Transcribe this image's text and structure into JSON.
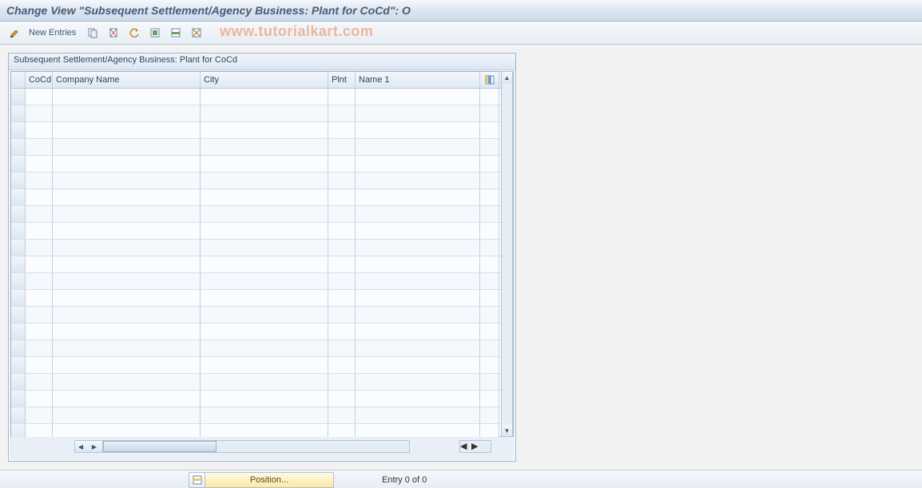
{
  "header": {
    "title": "Change View \"Subsequent Settlement/Agency Business: Plant for CoCd\": O"
  },
  "toolbar": {
    "new_entries_label": "New Entries"
  },
  "watermark": "www.tutorialkart.com",
  "panel": {
    "title": "Subsequent Settlement/Agency Business: Plant for CoCd",
    "columns": {
      "cocd": "CoCd",
      "company_name": "Company Name",
      "city": "City",
      "plnt": "Plnt",
      "name1": "Name 1"
    },
    "rows": [
      {
        "cocd": "",
        "company_name": "",
        "city": "",
        "plnt": "",
        "name1": ""
      },
      {
        "cocd": "",
        "company_name": "",
        "city": "",
        "plnt": "",
        "name1": ""
      },
      {
        "cocd": "",
        "company_name": "",
        "city": "",
        "plnt": "",
        "name1": ""
      },
      {
        "cocd": "",
        "company_name": "",
        "city": "",
        "plnt": "",
        "name1": ""
      },
      {
        "cocd": "",
        "company_name": "",
        "city": "",
        "plnt": "",
        "name1": ""
      },
      {
        "cocd": "",
        "company_name": "",
        "city": "",
        "plnt": "",
        "name1": ""
      },
      {
        "cocd": "",
        "company_name": "",
        "city": "",
        "plnt": "",
        "name1": ""
      },
      {
        "cocd": "",
        "company_name": "",
        "city": "",
        "plnt": "",
        "name1": ""
      },
      {
        "cocd": "",
        "company_name": "",
        "city": "",
        "plnt": "",
        "name1": ""
      },
      {
        "cocd": "",
        "company_name": "",
        "city": "",
        "plnt": "",
        "name1": ""
      },
      {
        "cocd": "",
        "company_name": "",
        "city": "",
        "plnt": "",
        "name1": ""
      },
      {
        "cocd": "",
        "company_name": "",
        "city": "",
        "plnt": "",
        "name1": ""
      },
      {
        "cocd": "",
        "company_name": "",
        "city": "",
        "plnt": "",
        "name1": ""
      },
      {
        "cocd": "",
        "company_name": "",
        "city": "",
        "plnt": "",
        "name1": ""
      },
      {
        "cocd": "",
        "company_name": "",
        "city": "",
        "plnt": "",
        "name1": ""
      },
      {
        "cocd": "",
        "company_name": "",
        "city": "",
        "plnt": "",
        "name1": ""
      },
      {
        "cocd": "",
        "company_name": "",
        "city": "",
        "plnt": "",
        "name1": ""
      },
      {
        "cocd": "",
        "company_name": "",
        "city": "",
        "plnt": "",
        "name1": ""
      },
      {
        "cocd": "",
        "company_name": "",
        "city": "",
        "plnt": "",
        "name1": ""
      },
      {
        "cocd": "",
        "company_name": "",
        "city": "",
        "plnt": "",
        "name1": ""
      },
      {
        "cocd": "",
        "company_name": "",
        "city": "",
        "plnt": "",
        "name1": ""
      }
    ]
  },
  "footer": {
    "position_label": "Position...",
    "entry_label": "Entry 0 of 0"
  }
}
